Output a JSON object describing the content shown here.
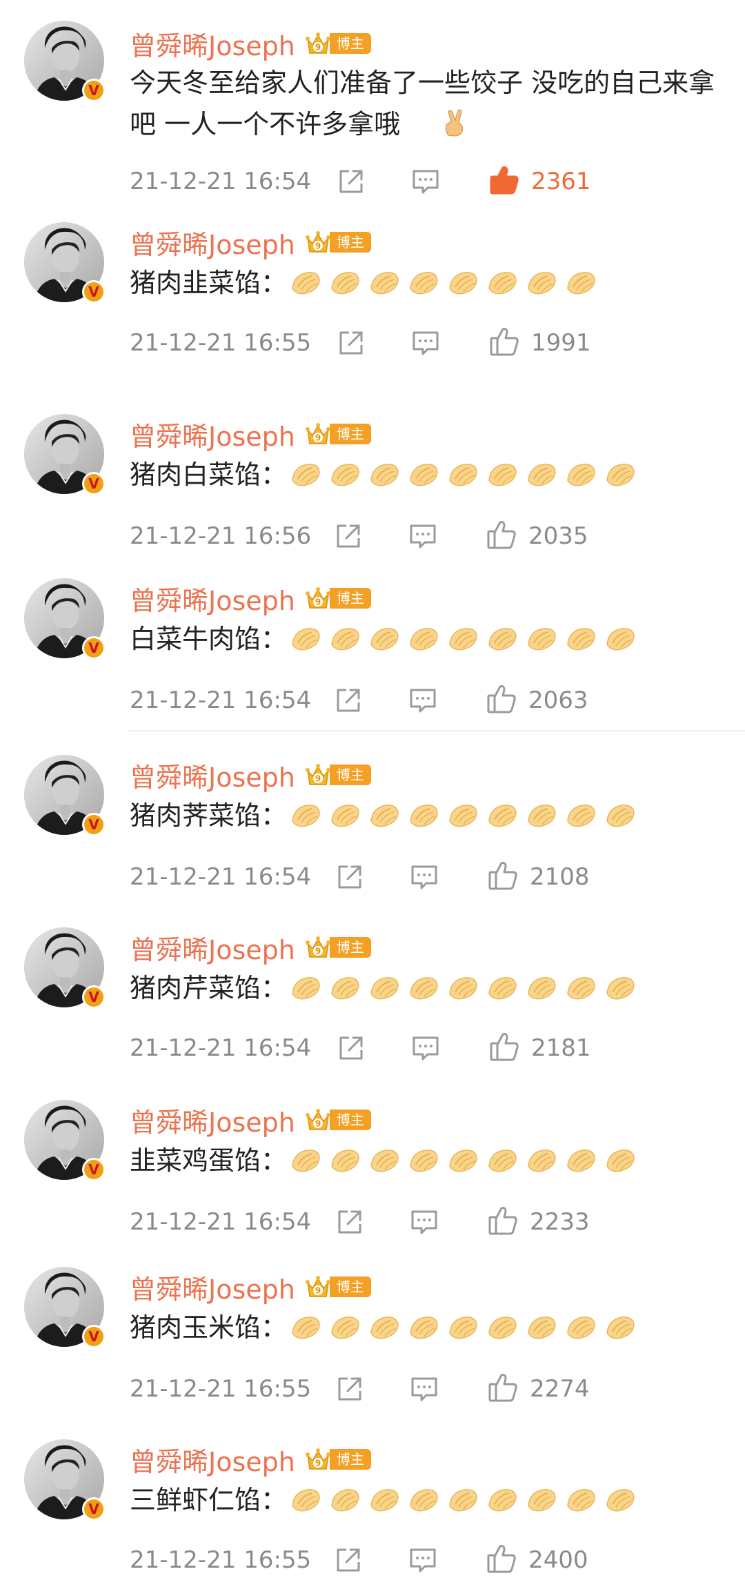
{
  "author": {
    "name": "曾舜晞Joseph",
    "badge": "博主",
    "crown_level": "9",
    "avatar_icon": "avatar-photo-icon",
    "verified_mark": "V"
  },
  "colors": {
    "username": "#eb7350",
    "badge": "#f3a024",
    "liked": "#ef6a33",
    "muted": "#8a8a8a",
    "dumpling": "#f7c66a"
  },
  "comments": [
    {
      "text": "今天冬至给家人们准备了一些饺子 没吃的自己来拿吧  一人一个不许多拿哦",
      "emoji": "victory-hand-icon",
      "time": "21-12-21 16:54",
      "likes": "2361",
      "liked": true,
      "dumplings": 0
    },
    {
      "text": "猪肉韭菜馅：",
      "time": "21-12-21 16:55",
      "likes": "1991",
      "liked": false,
      "dumplings": 8
    },
    {
      "text": "猪肉白菜馅：",
      "time": "21-12-21 16:56",
      "likes": "2035",
      "liked": false,
      "dumplings": 9
    },
    {
      "text": "白菜牛肉馅：",
      "time": "21-12-21 16:54",
      "likes": "2063",
      "liked": false,
      "dumplings": 9
    },
    {
      "text": "猪肉荠菜馅：",
      "time": "21-12-21 16:54",
      "likes": "2108",
      "liked": false,
      "dumplings": 9
    },
    {
      "text": "猪肉芹菜馅：",
      "time": "21-12-21 16:54",
      "likes": "2181",
      "liked": false,
      "dumplings": 9
    },
    {
      "text": "韭菜鸡蛋馅：",
      "time": "21-12-21 16:54",
      "likes": "2233",
      "liked": false,
      "dumplings": 9
    },
    {
      "text": "猪肉玉米馅：",
      "time": "21-12-21 16:55",
      "likes": "2274",
      "liked": false,
      "dumplings": 9
    },
    {
      "text": "三鲜虾仁馅：",
      "time": "21-12-21 16:55",
      "likes": "2400",
      "liked": false,
      "dumplings": 9
    }
  ]
}
